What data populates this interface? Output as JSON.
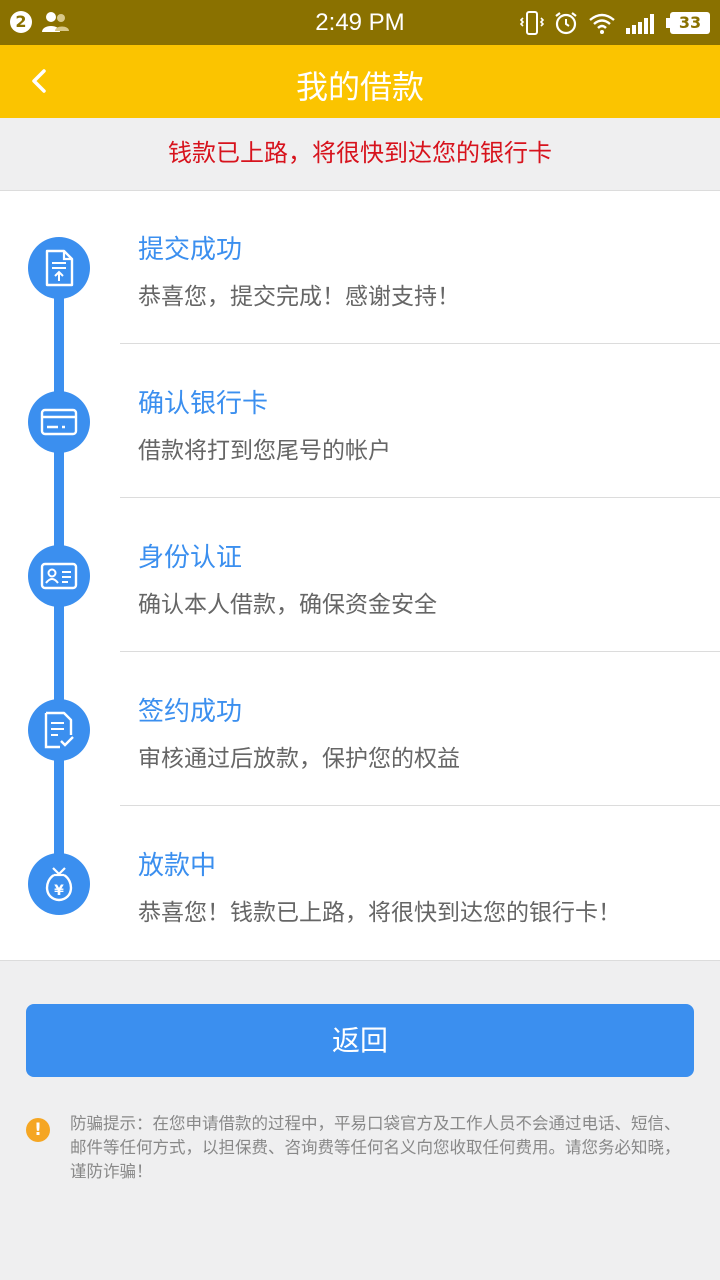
{
  "statusbar": {
    "notification_count": "2",
    "time": "2:49 PM",
    "battery": "33"
  },
  "header": {
    "title": "我的借款"
  },
  "notice": {
    "text": "钱款已上路，将很快到达您的银行卡"
  },
  "steps": [
    {
      "title": "提交成功",
      "desc": "恭喜您，提交完成！感谢支持！",
      "icon": "document-upload-icon"
    },
    {
      "title": "确认银行卡",
      "desc": "借款将打到您尾号的帐户",
      "icon": "bank-card-icon"
    },
    {
      "title": "身份认证",
      "desc": "确认本人借款，确保资金安全",
      "icon": "id-card-icon"
    },
    {
      "title": "签约成功",
      "desc": "审核通过后放款，保护您的权益",
      "icon": "contract-check-icon"
    },
    {
      "title": "放款中",
      "desc": "恭喜您！钱款已上路，将很快到达您的银行卡！",
      "icon": "money-bag-icon"
    }
  ],
  "actions": {
    "return_label": "返回"
  },
  "warning": {
    "icon": "!",
    "text": "防骗提示：在您申请借款的过程中，平易口袋官方及工作人员不会通过电话、短信、邮件等任何方式，以担保费、咨询费等任何名义向您收取任何费用。请您务必知晓，谨防诈骗！"
  },
  "colors": {
    "title_bar": "#fbc400",
    "accent_blue": "#3b8fef",
    "notice_red": "#d7131d",
    "warning_orange": "#f5a623"
  }
}
